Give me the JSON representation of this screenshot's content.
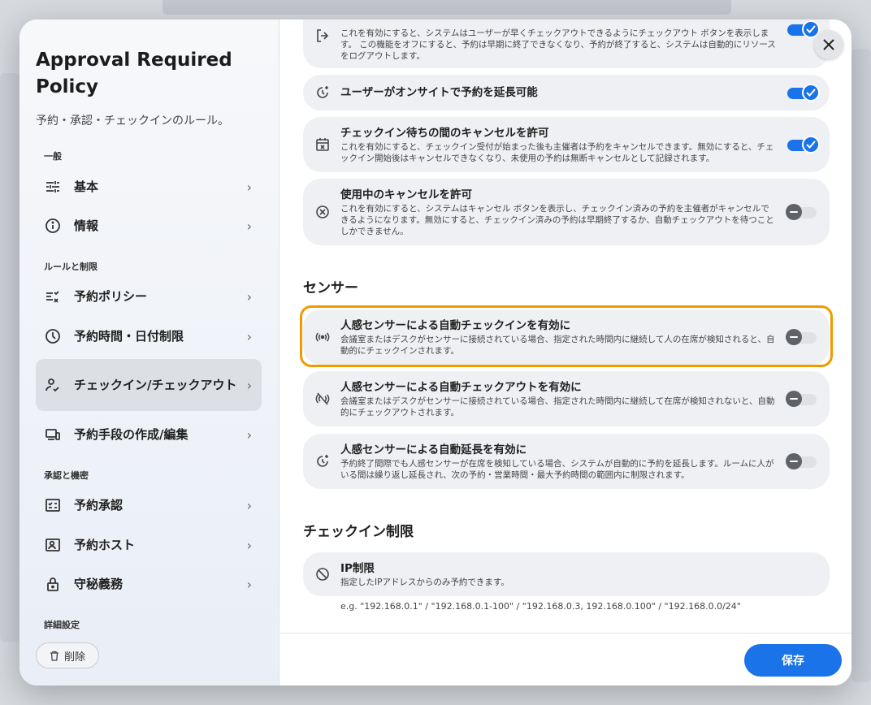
{
  "sidebar": {
    "title": "Approval Required Policy",
    "subtitle": "予約・承認・チェックインのルール。",
    "sections": [
      "一般",
      "ルールと制限",
      "承認と機密",
      "詳細設定"
    ],
    "items": [
      {
        "label": "基本",
        "icon": "sliders-icon"
      },
      {
        "label": "情報",
        "icon": "info-icon"
      },
      {
        "label": "予約ポリシー",
        "icon": "checklist-icon"
      },
      {
        "label": "予約時間・日付制限",
        "icon": "clock-icon"
      },
      {
        "label": "チェックイン/チェックアウト",
        "icon": "person-check-icon",
        "active": true
      },
      {
        "label": "予約手段の作成/編集",
        "icon": "devices-icon"
      },
      {
        "label": "予約承認",
        "icon": "approval-icon"
      },
      {
        "label": "予約ホスト",
        "icon": "host-icon"
      },
      {
        "label": "守秘義務",
        "icon": "lock-icon"
      }
    ],
    "delete_label": "削除"
  },
  "cards": [
    {
      "title": "",
      "desc": "これを有効にすると、システムはユーザーが早くチェックアウトできるようにチェックアウト ボタンを表示します。 この機能をオフにすると、予約は早期に終了できなくなり、予約が終了すると、システムは自動的にリソースをログアウトします。",
      "enabled": true,
      "icon": "logout-icon"
    },
    {
      "title": "ユーザーがオンサイトで予約を延長可能",
      "desc": "",
      "enabled": true,
      "icon": "extend-time-icon"
    },
    {
      "title": "チェックイン待ちの間のキャンセルを許可",
      "desc": "これを有効にすると、チェックイン受付が始まった後も主催者は予約をキャンセルできます。無効にすると、チェックイン開始後はキャンセルできなくなり、未使用の予約は無断キャンセルとして記録されます。",
      "enabled": true,
      "icon": "calendar-cancel-icon"
    },
    {
      "title": "使用中のキャンセルを許可",
      "desc": "これを有効にすると、システムはキャンセル ボタンを表示し、チェックイン済みの予約を主催者がキャンセルできるようになります。無効にすると、チェックイン済みの予約は早期終了するか、自動チェックアウトを待つことしかできません。",
      "enabled": false,
      "icon": "cancel-circle-icon"
    }
  ],
  "sensor_section": "センサー",
  "sensor_cards": [
    {
      "title": "人感センサーによる自動チェックインを有効に",
      "desc": "会議室またはデスクがセンサーに接続されている場合、指定された時間内に継続して人の在席が検知されると、自動的にチェックインされます。",
      "enabled": false,
      "icon": "sensor-icon"
    },
    {
      "title": "人感センサーによる自動チェックアウトを有効に",
      "desc": "会議室またはデスクがセンサーに接続されている場合、指定された時間内に継続して在席が検知されないと、自動的にチェックアウトされます。",
      "enabled": false,
      "icon": "sensor-off-icon"
    },
    {
      "title": "人感センサーによる自動延長を有効に",
      "desc": "予約終了間際でも人感センサーが在席を検知している場合、システムが自動的に予約を延長します。ルームに人がいる間は繰り返し延長され、次の予約・営業時間・最大予約時間の範囲内に制限されます。",
      "enabled": false,
      "icon": "auto-extend-icon"
    }
  ],
  "checkin_section": "チェックイン制限",
  "ip_card": {
    "title": "IP制限",
    "desc": "指定したIPアドレスからのみ予約できます。",
    "icon": "block-icon"
  },
  "ip_hint": "e.g. \"192.168.0.1\" / \"192.168.0.1-100\" / \"192.168.0.3, 192.168.0.100\" / \"192.168.0.0/24\"",
  "save_label": "保存",
  "colors": {
    "accent": "#1a73e8",
    "highlight": "#f29900"
  }
}
